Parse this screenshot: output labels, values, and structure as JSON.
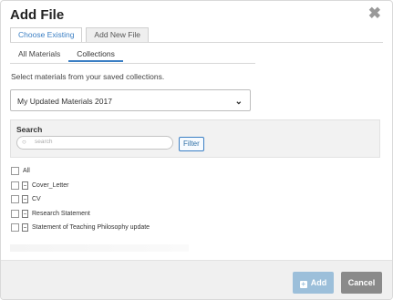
{
  "dialog": {
    "title": "Add File",
    "close_glyph": "✖"
  },
  "top_tabs": [
    {
      "label": "Choose Existing",
      "active": true
    },
    {
      "label": "Add New File",
      "active": false
    }
  ],
  "sub_tabs": [
    {
      "label": "All Materials",
      "active": false
    },
    {
      "label": "Collections",
      "active": true
    }
  ],
  "instruction": "Select materials from your saved collections.",
  "collection_select": {
    "value": "My Updated Materials 2017",
    "icon": "chevron-down-icon"
  },
  "search": {
    "label": "Search",
    "placeholder": "search",
    "filter_label": "Filter"
  },
  "list": {
    "all_label": "All",
    "items": [
      {
        "label": "Cover_Letter"
      },
      {
        "label": "CV"
      },
      {
        "label": "Research Statement"
      },
      {
        "label": "Statement of Teaching Philosophy update"
      }
    ]
  },
  "footer": {
    "add_label": "Add",
    "cancel_label": "Cancel"
  },
  "colors": {
    "accent": "#3b7fc4",
    "add_button": "#9cbfda",
    "cancel_button": "#8a8a8a"
  }
}
